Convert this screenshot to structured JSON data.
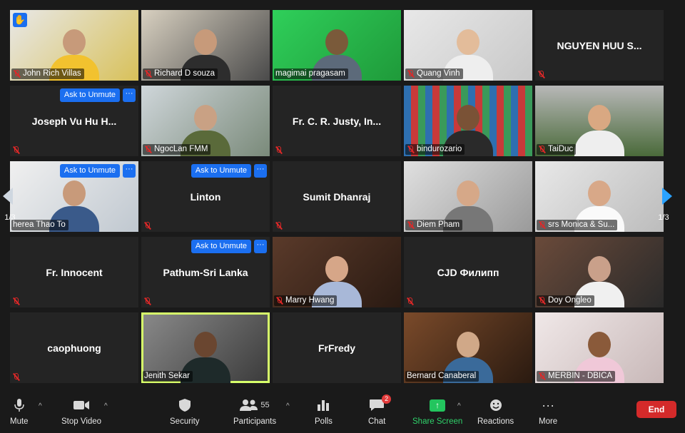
{
  "pager": {
    "left": "1/3",
    "right": "1/3"
  },
  "tiles": [
    {
      "name": "John Rich Villas",
      "big": ""
    },
    {
      "name": "Richard D souza",
      "big": ""
    },
    {
      "name": "magimai pragasam",
      "big": ""
    },
    {
      "name": "Quang Vinh",
      "big": ""
    },
    {
      "name": "",
      "big": "NGUYEN HUU S..."
    },
    {
      "name": "",
      "big": "Joseph Vu Hu H...",
      "unmute": "Ask to Unmute"
    },
    {
      "name": "NgocLan FMM",
      "big": ""
    },
    {
      "name": "",
      "big": "Fr. C. R. Justy, In..."
    },
    {
      "name": "bindurozario",
      "big": ""
    },
    {
      "name": "TaiDuc",
      "big": ""
    },
    {
      "name": "herea Thao To",
      "big": "",
      "unmute": "Ask to Unmute"
    },
    {
      "name": "",
      "big": "Linton",
      "unmute": "Ask to Unmute"
    },
    {
      "name": "",
      "big": "Sumit Dhanraj"
    },
    {
      "name": "Diem Pham",
      "big": ""
    },
    {
      "name": "srs Monica & Su...",
      "big": ""
    },
    {
      "name": "",
      "big": "Fr. Innocent"
    },
    {
      "name": "",
      "big": "Pathum-Sri Lanka",
      "unmute": "Ask to Unmute"
    },
    {
      "name": "Marry Hwang",
      "big": ""
    },
    {
      "name": "",
      "big": "CJD Филипп"
    },
    {
      "name": "Doy Ongleo",
      "big": ""
    },
    {
      "name": "",
      "big": "caophuong"
    },
    {
      "name": "Jenith Sekar",
      "big": ""
    },
    {
      "name": "",
      "big": "FrFredy"
    },
    {
      "name": "Bernard Canaberal",
      "big": ""
    },
    {
      "name": "MERBIN - DBICA",
      "big": ""
    }
  ],
  "more_glyph": "···",
  "toolbar": {
    "mute": "Mute",
    "stop_video": "Stop Video",
    "security": "Security",
    "participants": "Participants",
    "participants_count": "55",
    "polls": "Polls",
    "chat": "Chat",
    "chat_badge": "2",
    "share_screen": "Share Screen",
    "reactions": "Reactions",
    "more": "More",
    "end": "End"
  },
  "colors": {
    "accent": "#1b6ff0",
    "active_speaker": "#d7ff6a",
    "share": "#23c55e",
    "end": "#d42a2a"
  }
}
